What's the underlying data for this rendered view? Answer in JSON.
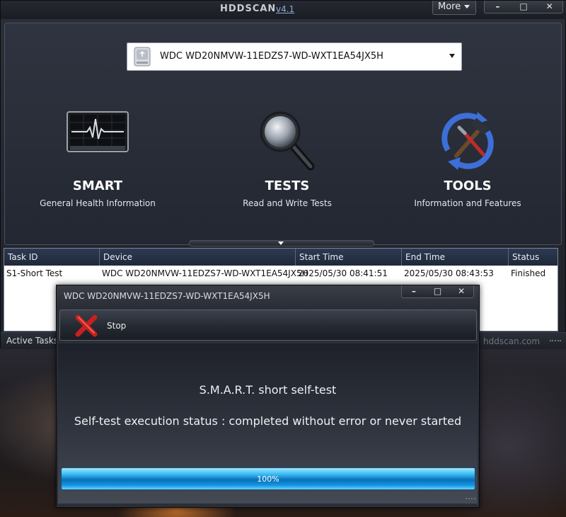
{
  "app": {
    "title": "HDDSCAN",
    "version": "v4.1"
  },
  "titlebar": {
    "more_label": "More",
    "minimize": "–",
    "maximize": "□",
    "close": "✕"
  },
  "drive": {
    "selected": "WDC WD20NMVW-11EDZS7-WD-WXT1EA54JX5H"
  },
  "features": [
    {
      "title": "SMART",
      "subtitle": "General Health Information",
      "icon": "monitor-heartbeat-icon"
    },
    {
      "title": "TESTS",
      "subtitle": "Read and Write Tests",
      "icon": "magnifier-icon"
    },
    {
      "title": "TOOLS",
      "subtitle": "Information and Features",
      "icon": "tools-hammer-icon"
    }
  ],
  "tasks": {
    "columns": [
      "Task ID",
      "Device",
      "Start Time",
      "End Time",
      "Status"
    ],
    "rows": [
      [
        "S1-Short Test",
        "WDC WD20NMVW-11EDZS7-WD-WXT1EA54JX5H",
        "2025/05/30 08:41:51",
        "2025/05/30 08:43:53",
        "Finished"
      ]
    ]
  },
  "statusbar": {
    "active_tasks": "Active Tasks",
    "site": "hddscan.com"
  },
  "dialog": {
    "title": "WDC WD20NMVW-11EDZS7-WD-WXT1EA54JX5H",
    "stop_label": "Stop",
    "line1": "S.M.A.R.T. short self-test",
    "line2": "Self-test execution status : completed without error or never started",
    "progress": 1.0,
    "progress_text": "100%"
  },
  "colors": {
    "accent": "#36b8f2",
    "header_bg": "#2e3a53",
    "window_bg": "#2b2f38"
  }
}
